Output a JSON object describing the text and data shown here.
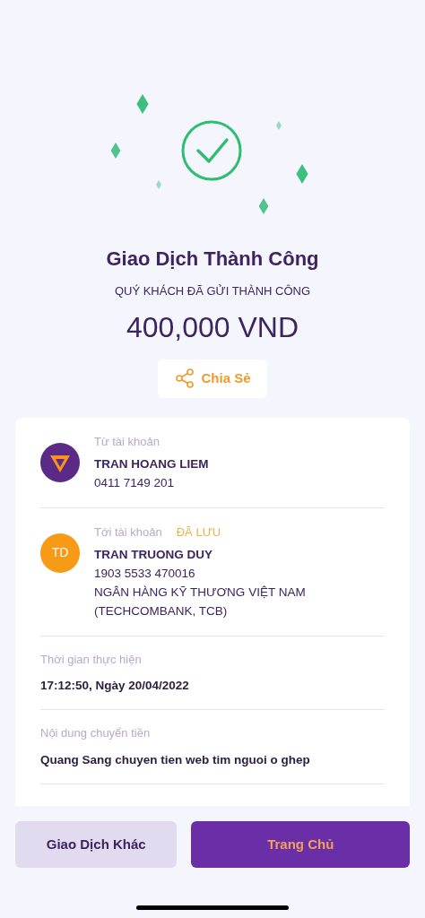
{
  "result": {
    "title": "Giao Dịch Thành Công",
    "subtitle": "QUÝ KHÁCH ĐÃ GỬI THÀNH CÔNG",
    "amount": "400,000 VND",
    "share_button": "Chia Sẻ"
  },
  "accounts": [
    {
      "kind": "logo",
      "label": "Từ tài khoản",
      "name": "TRAN HOANG LIEM",
      "lines": [
        "0411 7149 201"
      ]
    },
    {
      "kind": "initials",
      "label": "Tới tài khoản",
      "tag": "ĐÃ LƯU",
      "initials": "TD",
      "name": "TRAN TRUONG DUY",
      "lines": [
        "1903 5533 470016",
        "NGÂN HÀNG KỸ THƯƠNG VIỆT NAM",
        "(TECHCOMBANK, TCB)"
      ]
    }
  ],
  "details": [
    {
      "label": "Thời gian thực hiện",
      "value": "17:12:50, Ngày 20/04/2022"
    },
    {
      "label": "Nội dung chuyển tiền",
      "value": "Quang Sang chuyen tien web tim nguoi o ghep"
    }
  ],
  "buttons": [
    {
      "kind": "secondary",
      "label": "Giao Dịch Khác"
    },
    {
      "kind": "primary",
      "label": "Trang Chủ"
    }
  ]
}
